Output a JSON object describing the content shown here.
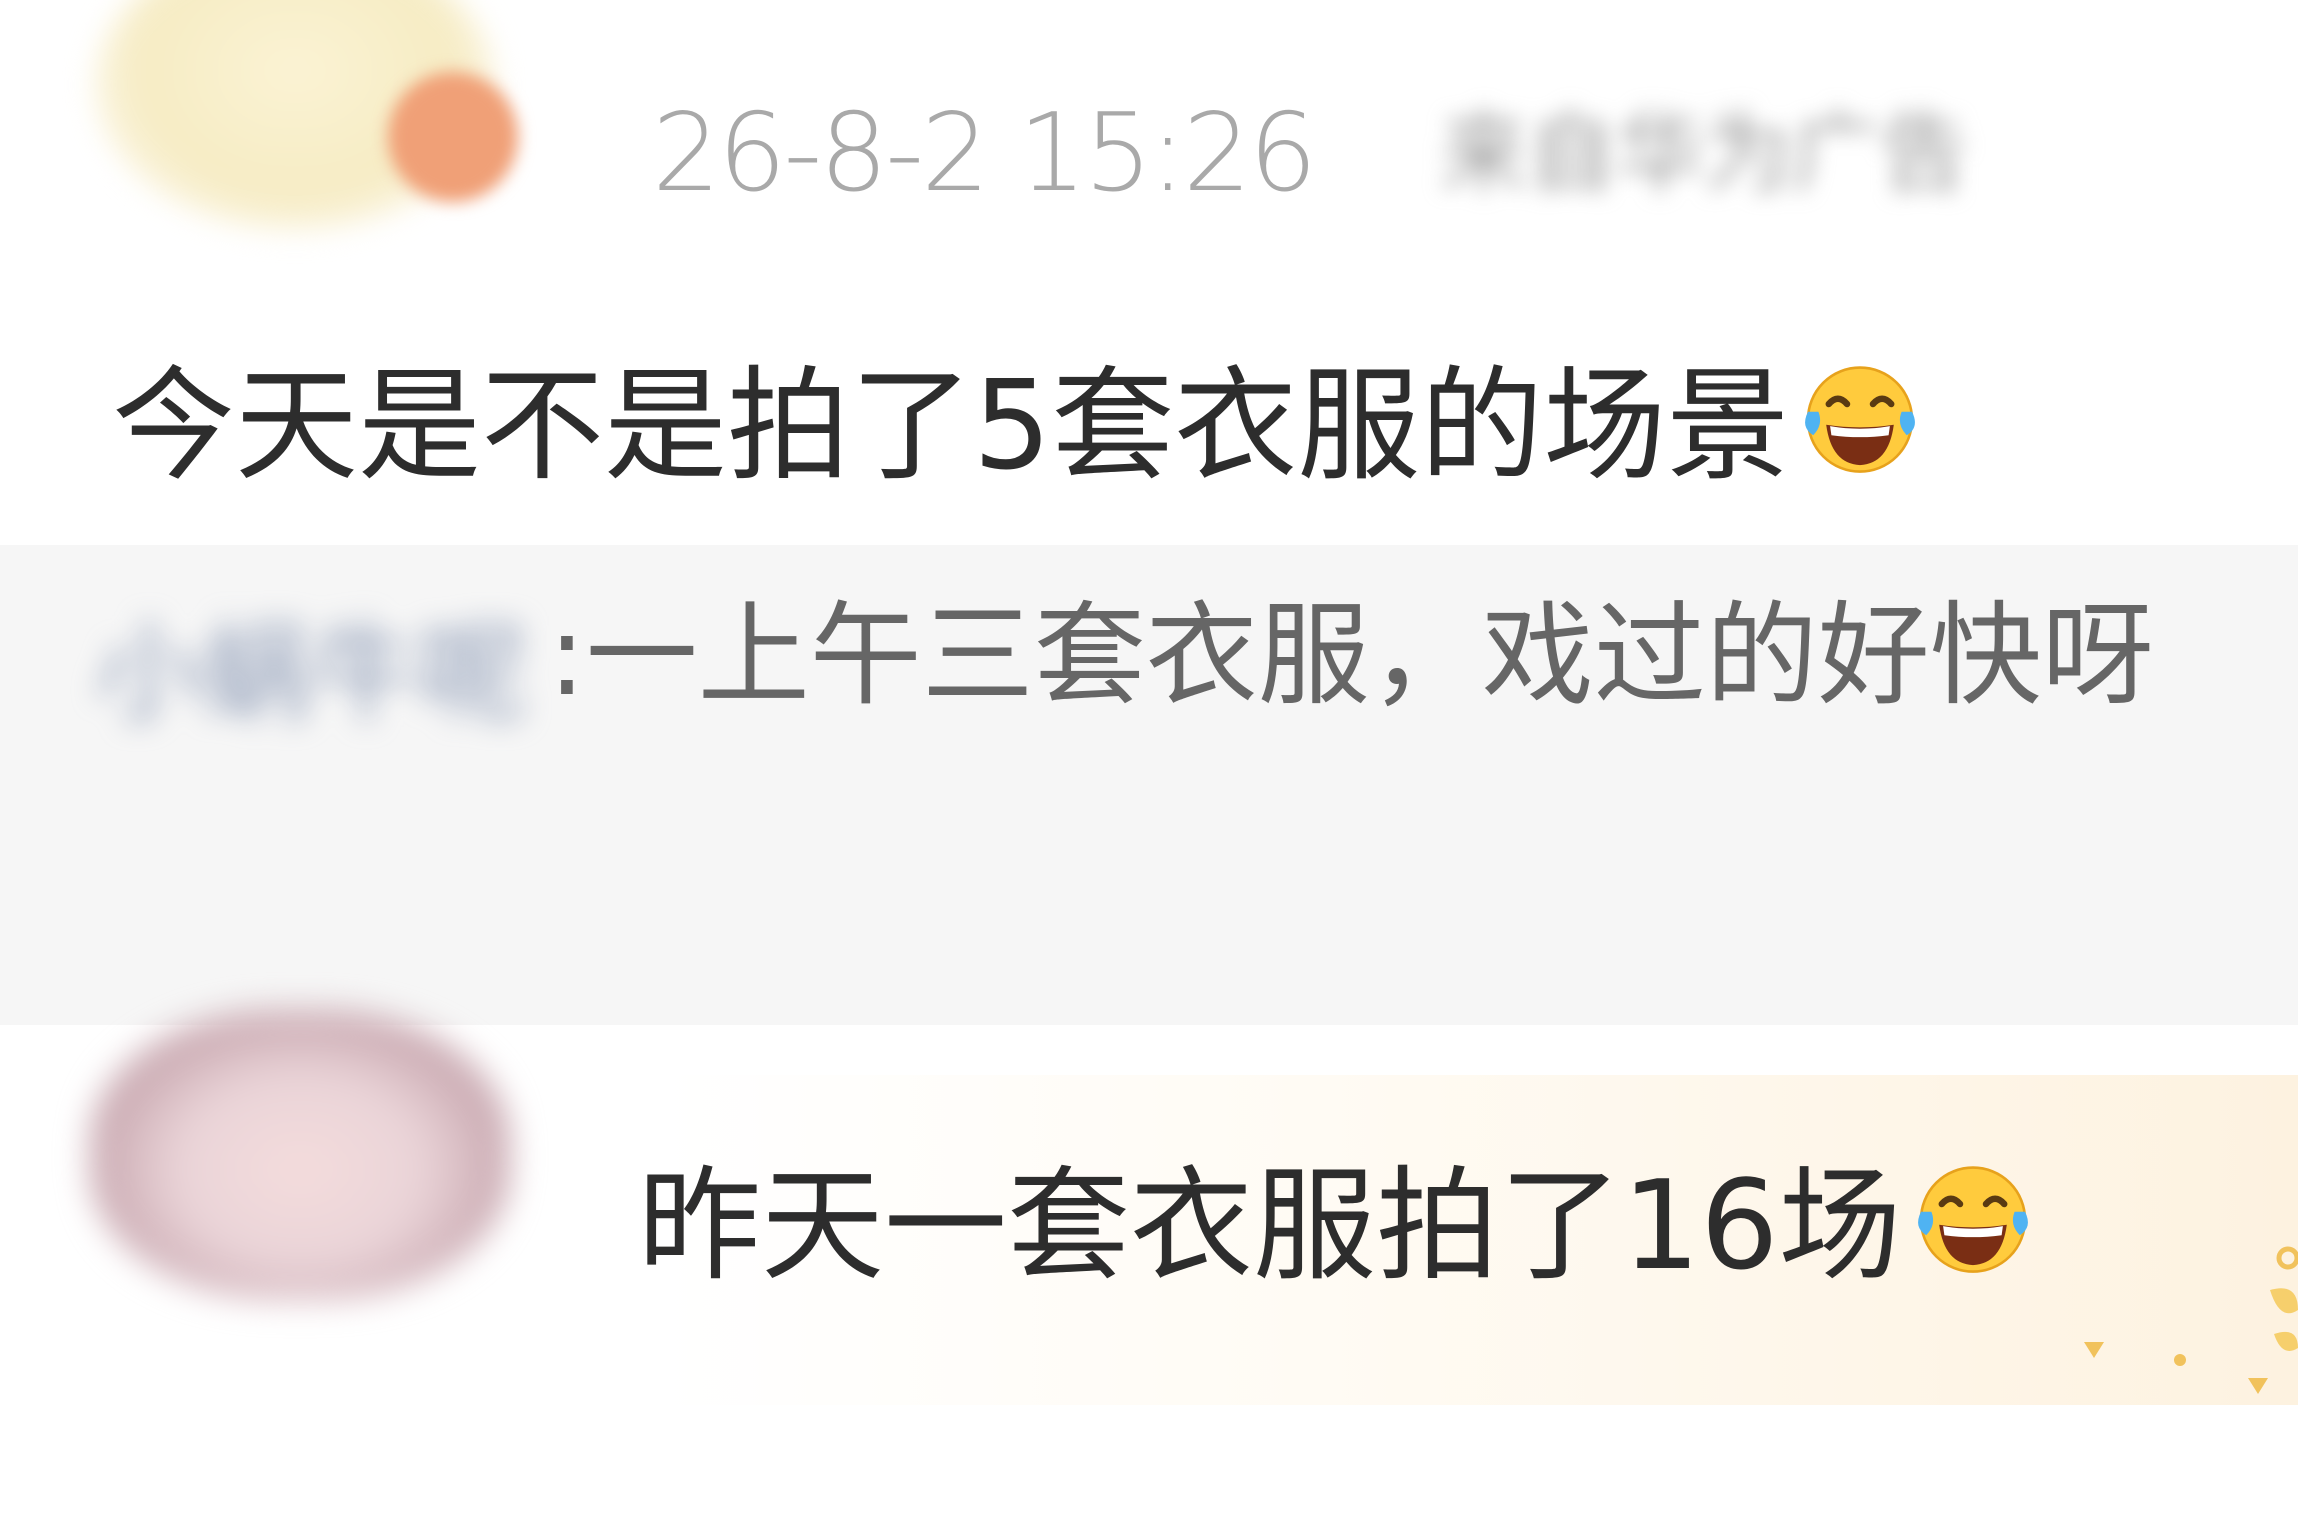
{
  "post": {
    "timestamp": "26-8-2 15:26",
    "source": "来自华为广告",
    "comment_text": "今天是不是拍了5套衣服的场景",
    "comment_emoji": "laughing-tears-emoji"
  },
  "quoted_reply": {
    "author_name": "小蜗牛呢",
    "text": ":一上午三套衣服，戏过的好快呀"
  },
  "reply": {
    "text": "昨天一套衣服拍了16场",
    "emoji": "laughing-tears-emoji"
  },
  "colors": {
    "timestamp": "#a9a9a9",
    "main_text": "#2d2d2d",
    "quote_text": "#666666",
    "quote_background": "#f6f6f6"
  }
}
